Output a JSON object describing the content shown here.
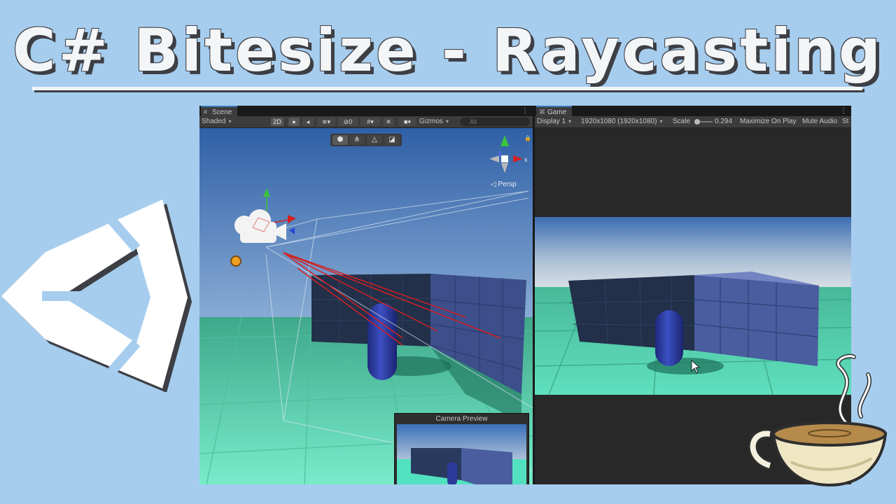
{
  "title": "C# Bitesize - Raycasting",
  "colors": {
    "background": "#a6cdee",
    "title_fill": "#f4f5f7",
    "title_shadow": "#3d3f45",
    "editor_dark": "#282828",
    "ray_red": "#d42020",
    "floor_teal": "#5fd6b4",
    "capsule_blue": "#2c3a9c"
  },
  "scene_panel": {
    "tab_label": "Scene",
    "toolbar": {
      "shading_mode": "Shaded",
      "mode_2d": "2D",
      "hidden_count": "0",
      "gizmos_label": "Gizmos",
      "search_placeholder": "All"
    },
    "projection_label": "◁ Persp",
    "gizmo_axis_label": "x",
    "camera_preview_title": "Camera Preview"
  },
  "game_panel": {
    "tab_label": "Game",
    "toolbar": {
      "display": "Display 1",
      "resolution": "1920x1080 (1920x1080)",
      "scale_label": "Scale",
      "scale_value": "0.294",
      "maximize_label": "Maximize On Play",
      "mute_label": "Mute Audio",
      "stats_label": "St"
    }
  },
  "icons": [
    "unity-logo-icon",
    "coffee-cup-icon",
    "scene-camera-icon",
    "light-gizmo-icon",
    "orientation-gizmo-icon",
    "mouse-cursor-icon"
  ]
}
